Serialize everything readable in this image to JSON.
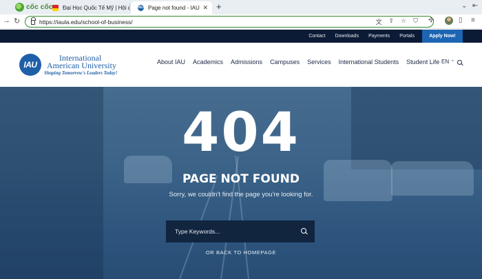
{
  "browser": {
    "brand": "cốc cốc",
    "tabs": [
      {
        "title": "Đại Học Quốc Tế Mỹ | Hội đồng K",
        "active": false
      },
      {
        "title": "Page not found - IAU",
        "active": true
      }
    ],
    "url": "https://iaula.edu/school-of-business/"
  },
  "topbar": {
    "links": [
      "Contact",
      "Downloads",
      "Payments",
      "Portals"
    ],
    "apply_label": "Apply Now!"
  },
  "header": {
    "logo_badge": "IAU",
    "logo_line1": "International",
    "logo_line2": "American University",
    "logo_tagline": "Shaping Tomorrow's Leaders Today!",
    "nav": [
      "About IAU",
      "Academics",
      "Admissions",
      "Campuses",
      "Services",
      "International Students",
      "Student Life"
    ],
    "lang": "EN"
  },
  "hero": {
    "code": "404",
    "title": "PAGE NOT FOUND",
    "subtitle": "Sorry, we couldn't find the page you're looking for.",
    "search_placeholder": "Type Keywords...",
    "back_link": "OR BACK TO HOMEPAGE"
  },
  "colors": {
    "topbar_bg": "#0c1b35",
    "accent": "#1d65b3",
    "hero_overlay": "#3c6388"
  }
}
